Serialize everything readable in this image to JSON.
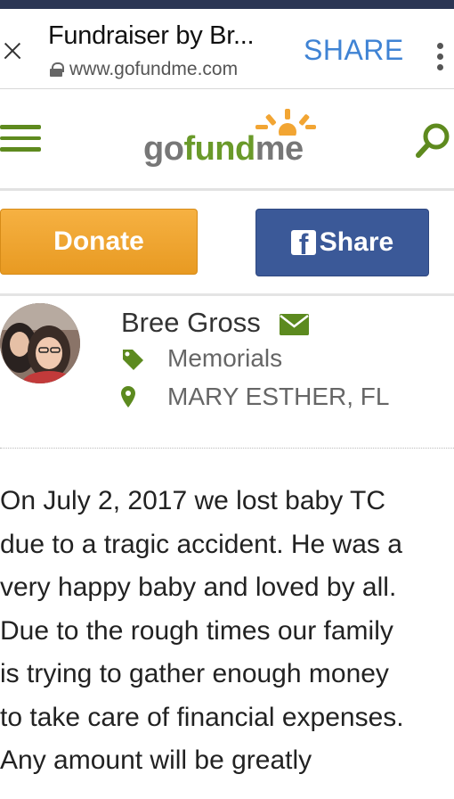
{
  "browser": {
    "tab_title": "Fundraiser by Br...",
    "url": "www.gofundme.com",
    "share_label": "SHARE"
  },
  "header": {
    "logo": {
      "go": "go",
      "fund": "fund",
      "me": "me"
    },
    "accent_color": "#6a9a2a"
  },
  "actions": {
    "donate_label": "Donate",
    "share_label": "Share",
    "donate_color": "#f0a733",
    "facebook_color": "#3b5998"
  },
  "organizer": {
    "name": "Bree Gross",
    "category": "Memorials",
    "location": "MARY ESTHER, FL"
  },
  "story": {
    "lines": [
      "On July 2, 2017 we lost baby TC",
      "due to a tragic accident. He was a",
      "very happy baby and loved by all.",
      "Due to the rough times our family",
      "is trying to gather enough money",
      "to take care of financial expenses.",
      "Any amount will be greatly"
    ]
  },
  "icons": [
    "close-icon",
    "lock-icon",
    "more-options-icon",
    "menu-icon",
    "search-icon",
    "facebook-icon",
    "mail-icon",
    "tag-icon",
    "location-pin-icon"
  ]
}
